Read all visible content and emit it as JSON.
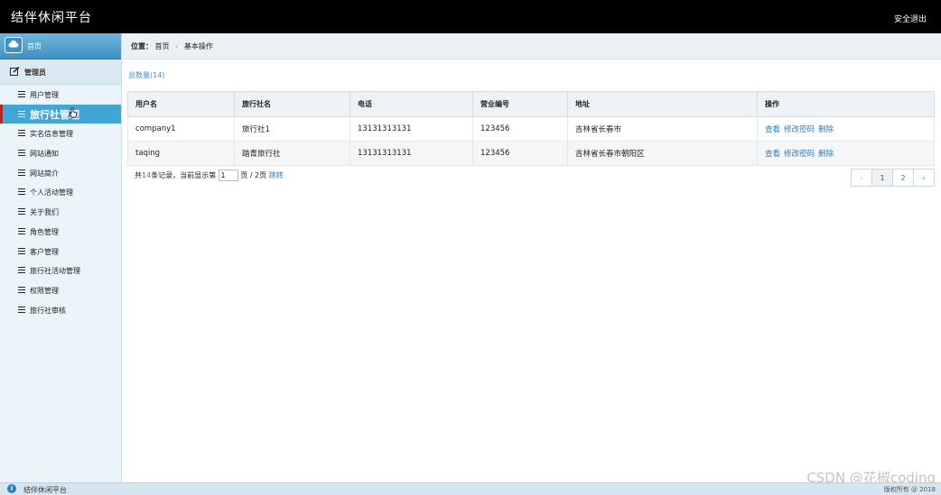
{
  "header": {
    "title": "结伴休闲平台",
    "logout": "安全退出"
  },
  "sidebar": {
    "home": "首页",
    "section": "管理员",
    "items": [
      {
        "label": "用户管理"
      },
      {
        "label": "旅行社管理"
      },
      {
        "label": "实名信息管理"
      },
      {
        "label": "网站通知"
      },
      {
        "label": "网站简介"
      },
      {
        "label": "个人活动管理"
      },
      {
        "label": "关于我们"
      },
      {
        "label": "角色管理"
      },
      {
        "label": "客户管理"
      },
      {
        "label": "旅行社活动管理"
      },
      {
        "label": "权限管理"
      },
      {
        "label": "旅行社审核"
      }
    ]
  },
  "breadcrumb": {
    "prefix": "位置：",
    "home": "首页",
    "sep": "›",
    "current": "基本操作"
  },
  "total": "总数量(14)",
  "table": {
    "headers": [
      "用户名",
      "旅行社名",
      "电话",
      "营业编号",
      "地址",
      "操作"
    ],
    "rows": [
      {
        "username": "company1",
        "agency": "旅行社1",
        "phone": "13131313131",
        "license": "123456",
        "address": "吉林省长春市"
      },
      {
        "username": "taqing",
        "agency": "踏青旅行社",
        "phone": "13131313131",
        "license": "123456",
        "address": "吉林省长春市朝阳区"
      }
    ],
    "actions": {
      "view": "查看",
      "change_password": "修改密码",
      "delete": "删除"
    }
  },
  "pager": {
    "prefix": "共",
    "count": "14",
    "mid": "条记录，当前显示第",
    "page_value": "1",
    "suffix": "页 / 2页",
    "jump": "跳转",
    "prev": "‹",
    "pages": [
      "1",
      "2"
    ],
    "next": "›"
  },
  "footer": {
    "name": "结伴休闲平台",
    "copyright": "版权所有 @ 2018"
  },
  "watermark": "CSDN @花椒coding",
  "colors": {
    "topbar": "#000000",
    "accent": "#42a5d6",
    "link": "#2c7fb8"
  }
}
